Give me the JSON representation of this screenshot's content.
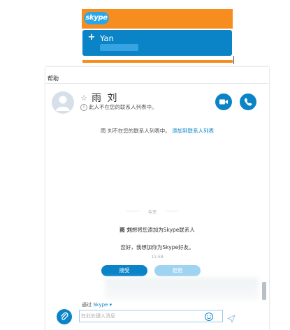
{
  "notification": {
    "logo_text": "skype",
    "name": "Yan"
  },
  "window": {
    "menu_label": "帮助"
  },
  "contact": {
    "name": "雨 刘",
    "status": "此人不在您的联系人列表中。"
  },
  "banner": {
    "text": "雨 刘不在您的联系人列表中。",
    "link": "添加到联系人列表"
  },
  "chat": {
    "day_label": "今天",
    "request_sender": "雨 刘",
    "request_text": "想将您添加为Skype联系人",
    "request_message": "您好，我想加你为Skype好友。",
    "request_time": "11:58",
    "accept_label": "接受",
    "decline_label": "拒绝"
  },
  "composer": {
    "via_label": "通过",
    "via_service": "Skype",
    "placeholder": "在此处键入消息"
  },
  "colors": {
    "skype_blue": "#0a84c7",
    "orange": "#f68d1e"
  }
}
